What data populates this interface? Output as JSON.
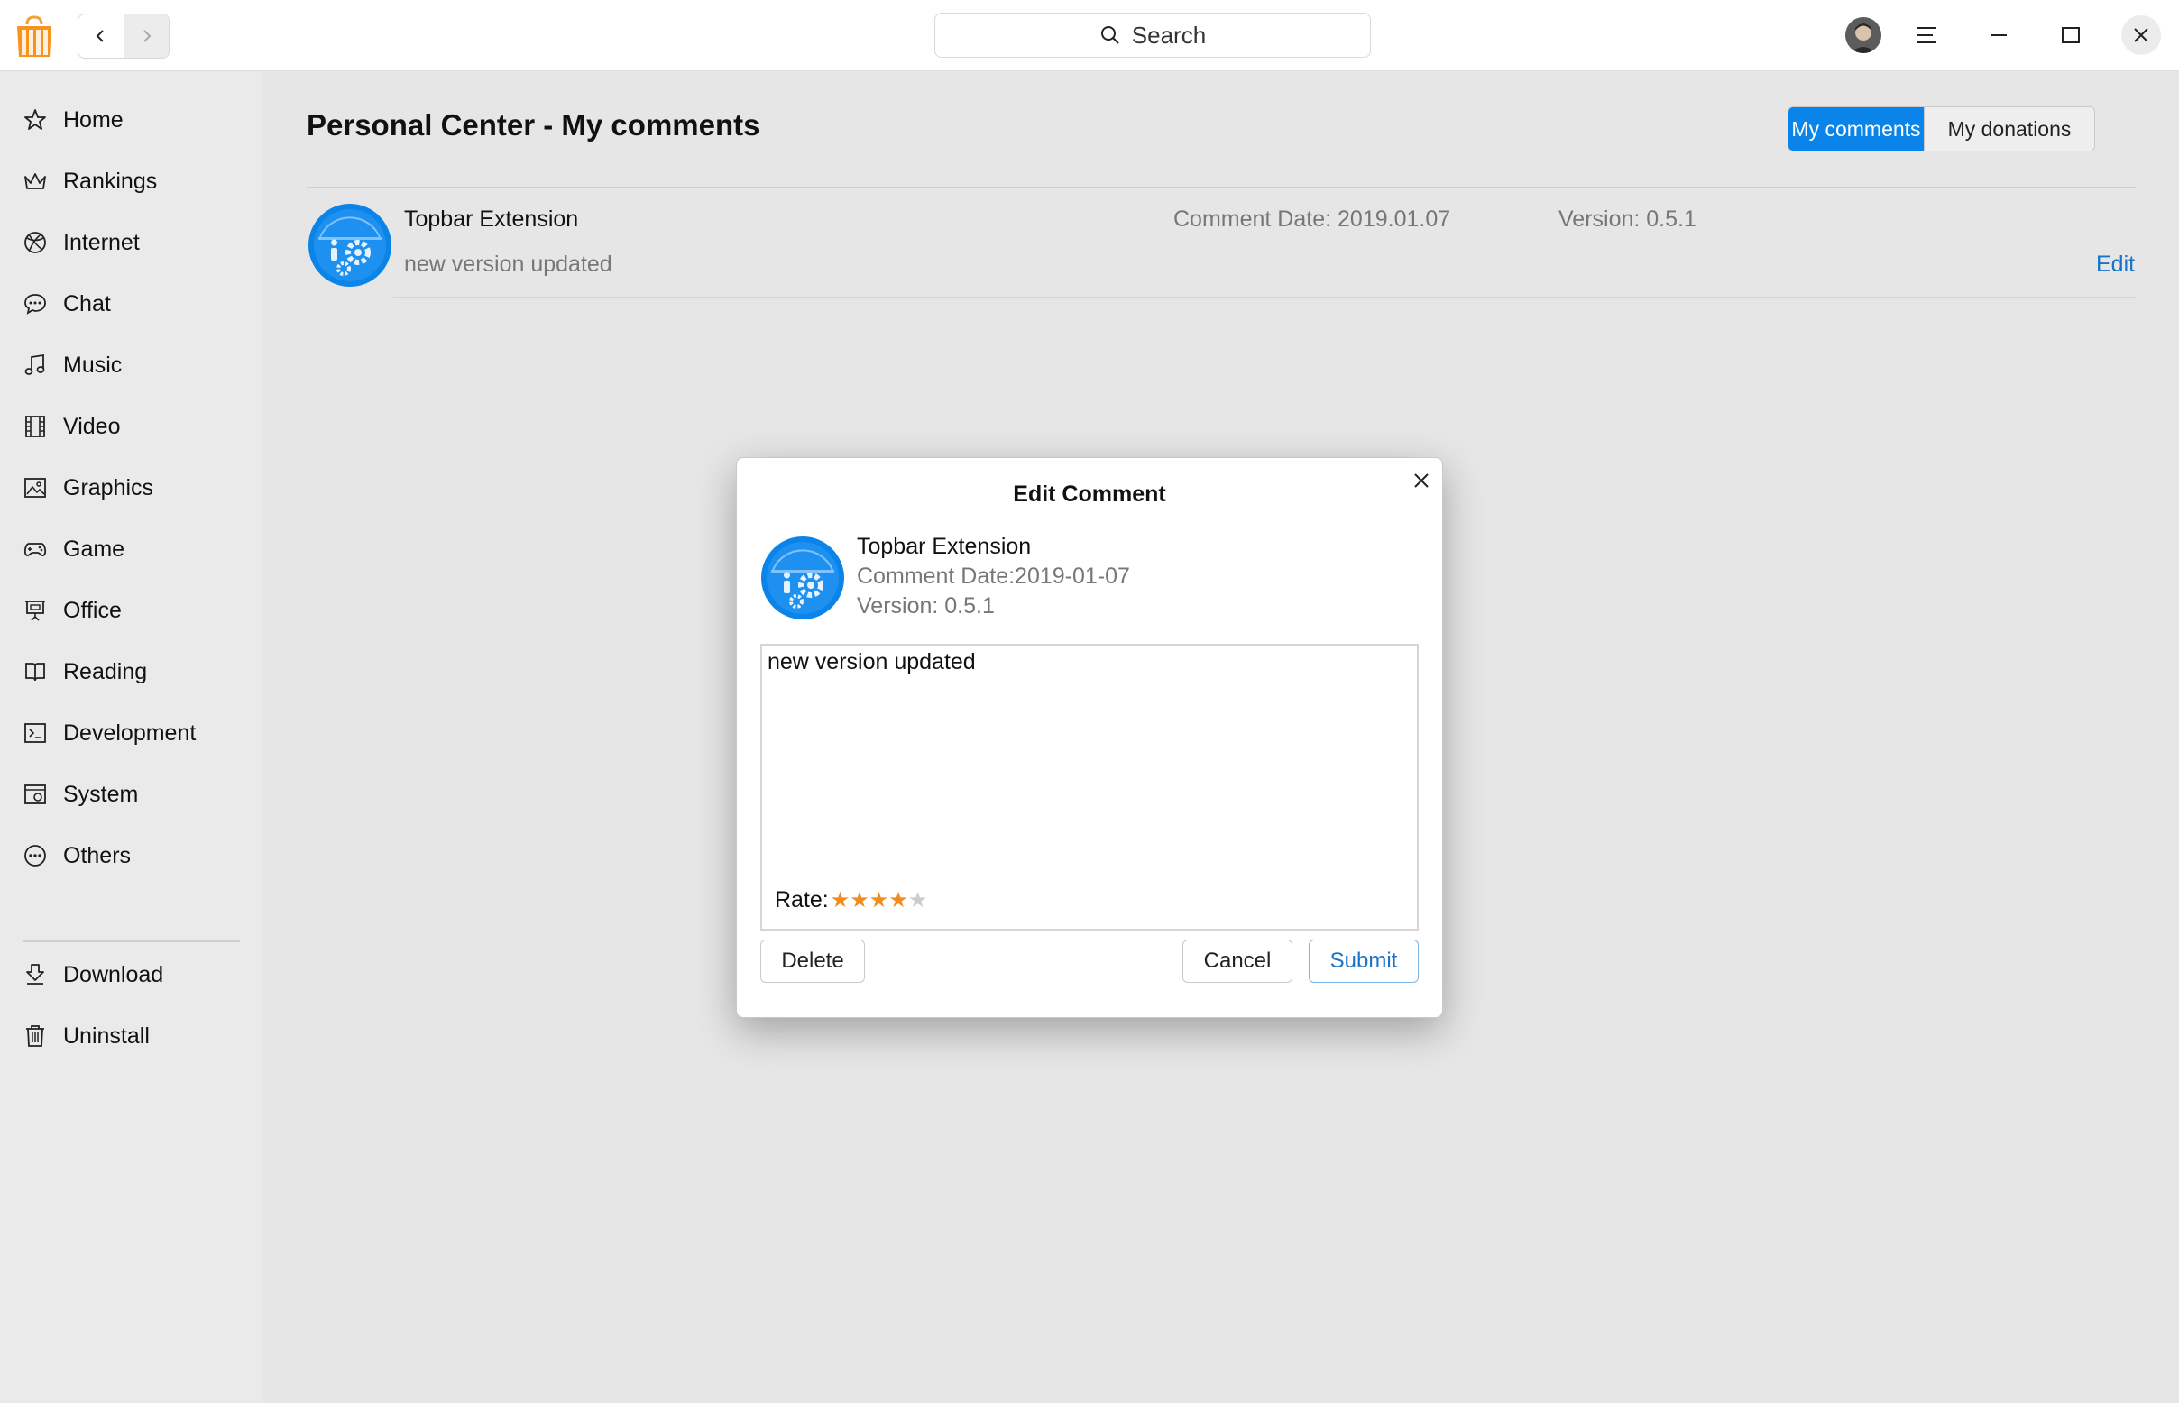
{
  "titlebar": {
    "search_placeholder": "Search",
    "back_icon": "chevron-left-icon",
    "forward_icon": "chevron-right-icon"
  },
  "sidebar": {
    "items": [
      {
        "label": "Home",
        "icon": "star-icon"
      },
      {
        "label": "Rankings",
        "icon": "crown-icon"
      },
      {
        "label": "Internet",
        "icon": "globe-icon"
      },
      {
        "label": "Chat",
        "icon": "chat-icon"
      },
      {
        "label": "Music",
        "icon": "music-note-icon"
      },
      {
        "label": "Video",
        "icon": "film-icon"
      },
      {
        "label": "Graphics",
        "icon": "image-icon"
      },
      {
        "label": "Game",
        "icon": "gamepad-icon"
      },
      {
        "label": "Office",
        "icon": "presentation-icon"
      },
      {
        "label": "Reading",
        "icon": "book-icon"
      },
      {
        "label": "Development",
        "icon": "terminal-icon"
      },
      {
        "label": "System",
        "icon": "system-icon"
      },
      {
        "label": "Others",
        "icon": "more-icon"
      }
    ],
    "bottom_items": [
      {
        "label": "Download",
        "icon": "download-icon"
      },
      {
        "label": "Uninstall",
        "icon": "trash-icon"
      }
    ]
  },
  "main": {
    "title": "Personal Center - My comments",
    "tabs": [
      {
        "label": "My comments",
        "active": true
      },
      {
        "label": "My donations",
        "active": false
      }
    ],
    "comments": [
      {
        "app_name": "Topbar Extension",
        "comment": "new version updated",
        "date": "Comment Date: 2019.01.07",
        "version": "Version: 0.5.1",
        "edit_label": "Edit"
      }
    ]
  },
  "dialog": {
    "title": "Edit Comment",
    "app_name": "Topbar Extension",
    "date": "Comment Date:2019-01-07",
    "version": "Version: 0.5.1",
    "comment_text": "new version updated",
    "rate_label": "Rate:",
    "rating": 4,
    "rating_max": 5,
    "delete_label": "Delete",
    "cancel_label": "Cancel",
    "submit_label": "Submit"
  },
  "colors": {
    "accent": "#0a84e8",
    "link": "#1a73c8",
    "star_filled": "#f28c1e",
    "star_empty": "#cccccc",
    "background": "#e6e6e6"
  }
}
